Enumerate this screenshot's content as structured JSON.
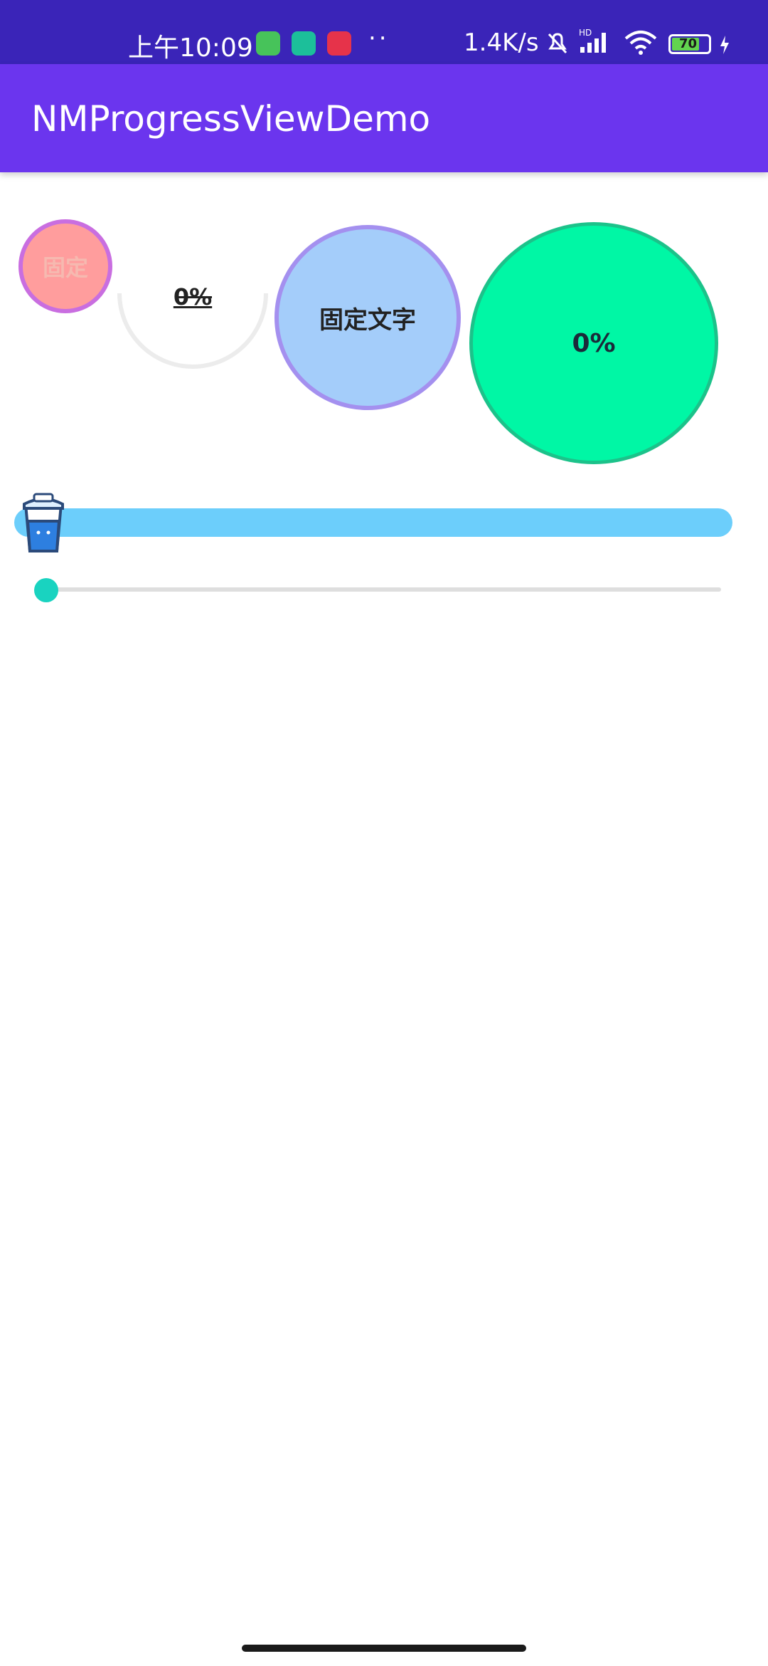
{
  "status_bar": {
    "time": "上午10:09",
    "dots": "··",
    "net_speed": "1.4K/s",
    "battery": "70",
    "colors": {
      "bg": "#3a24b8"
    }
  },
  "app_bar": {
    "title": "NMProgressViewDemo",
    "colors": {
      "bg": "#6b35ee"
    }
  },
  "progress_views": {
    "small_circle": {
      "label": "固定"
    },
    "arc": {
      "label": "0%",
      "progress": 0
    },
    "blue_circle": {
      "label": "固定文字"
    },
    "green_circle": {
      "label": "0%",
      "progress": 0
    },
    "cup_bar": {
      "progress": 0,
      "colors": {
        "track": "#6ccefb"
      }
    },
    "line_bar": {
      "progress": 0,
      "colors": {
        "track": "#dedede",
        "thumb": "#19d3c0"
      }
    }
  }
}
